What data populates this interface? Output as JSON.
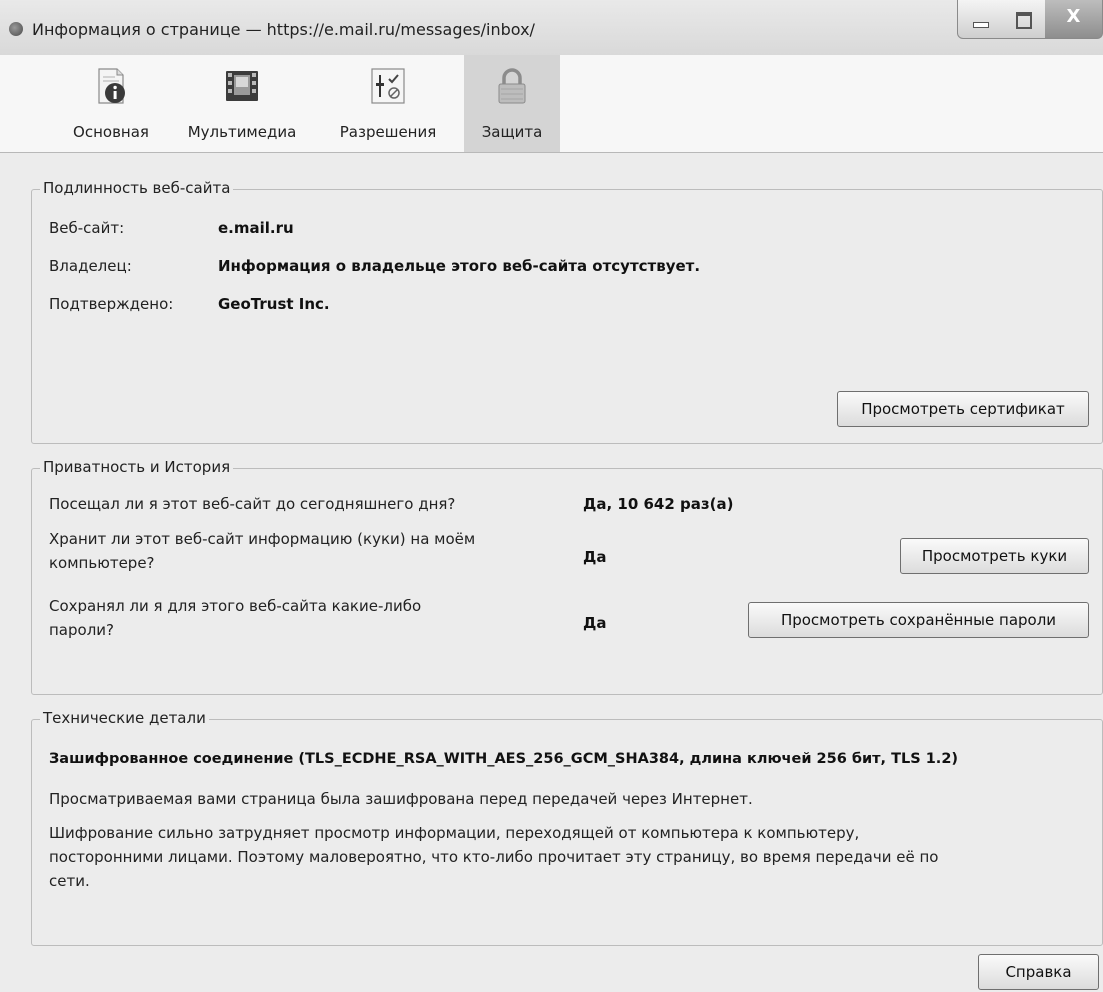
{
  "window": {
    "title": "Информация о странице — https://e.mail.ru/messages/inbox/",
    "close_glyph": "X"
  },
  "tabs": [
    {
      "label": "Основная",
      "icon": "page-info-icon"
    },
    {
      "label": "Мультимедиа",
      "icon": "media-icon"
    },
    {
      "label": "Разрешения",
      "icon": "permissions-icon"
    },
    {
      "label": "Защита",
      "icon": "lock-icon",
      "active": true
    }
  ],
  "identity": {
    "legend": "Подлинность веб-сайта",
    "website_label": "Веб-сайт:",
    "website_value": "e.mail.ru",
    "owner_label": "Владелец:",
    "owner_value": "Информация о владельце этого веб-сайта отсутствует.",
    "verified_label": "Подтверждено:",
    "verified_value": "GeoTrust Inc.",
    "view_cert_button": "Просмотреть сертификат"
  },
  "privacy": {
    "legend": "Приватность и История",
    "visited_question": "Посещал ли я этот веб-сайт до сегодняшнего дня?",
    "visited_answer": "Да, 10 642 раз(а)",
    "cookies_question_line1": "Хранит ли этот веб-сайт информацию (куки) на моём",
    "cookies_question_line2": "компьютере?",
    "cookies_answer": "Да",
    "view_cookies_button": "Просмотреть куки",
    "passwords_question_line1": "Сохранял ли я для этого веб-сайта какие-либо",
    "passwords_question_line2": "пароли?",
    "passwords_answer": "Да",
    "view_passwords_button": "Просмотреть сохранённые пароли"
  },
  "technical": {
    "legend": "Технические детали",
    "connection": "Зашифрованное соединение (TLS_ECDHE_RSA_WITH_AES_256_GCM_SHA384, длина ключей 256 бит, TLS 1.2)",
    "line1": "Просматриваемая вами страница была зашифрована перед передачей через Интернет.",
    "line2a": "Шифрование сильно затрудняет просмотр информации, переходящей от компьютера к компьютеру,",
    "line2b": "посторонними лицами. Поэтому маловероятно, что кто-либо прочитает эту страницу, во время передачи её по",
    "line2c": "сети."
  },
  "footer": {
    "help_button": "Справка"
  }
}
